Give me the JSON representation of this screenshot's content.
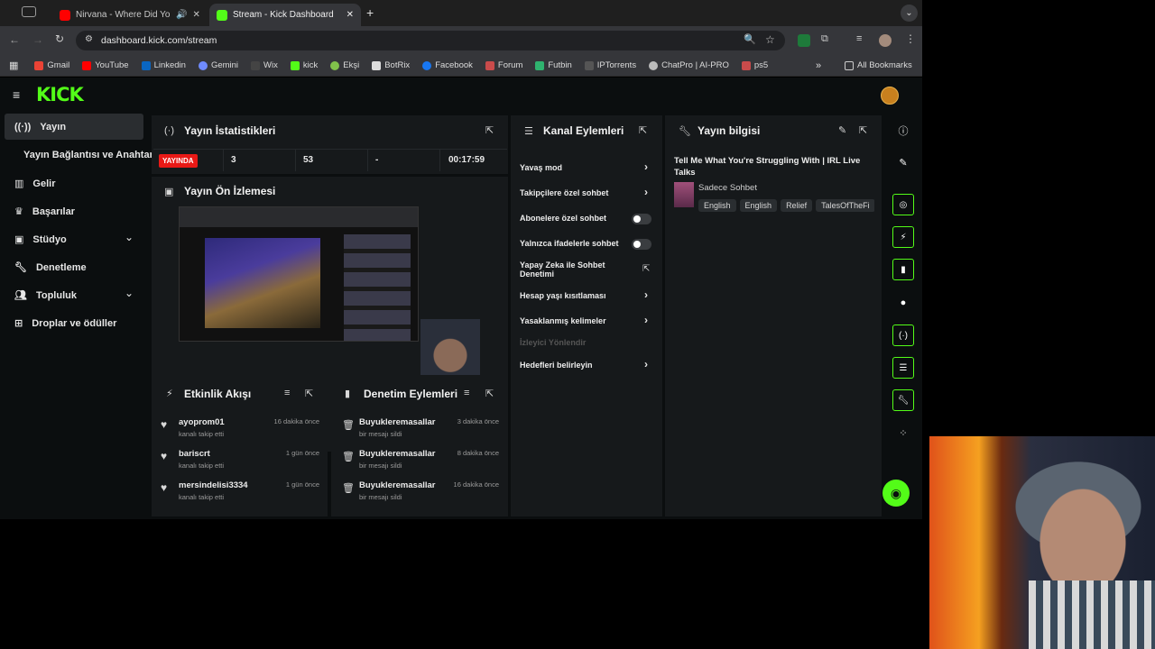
{
  "browser": {
    "tabs": [
      {
        "title": "Nirvana - Where Did You S",
        "audio": "speaker-icon"
      },
      {
        "title": "Stream - Kick Dashboard"
      }
    ],
    "url": "dashboard.kick.com/stream",
    "bookmarks": [
      "Gmail",
      "YouTube",
      "Linkedin",
      "Gemini",
      "Wix",
      "kick",
      "Ekşi",
      "BotRix",
      "Facebook",
      "Forum",
      "Futbin",
      "IPTorrents",
      "ChatPro | AI-PRO",
      "ps5"
    ],
    "all_bookmarks": "All Bookmarks"
  },
  "sidebar": {
    "items": [
      {
        "label": "Yayın",
        "icon": "broadcast-icon"
      },
      {
        "label": "Yayın Bağlantısı ve Anahtarı"
      },
      {
        "label": "Gelir",
        "icon": "chart-icon"
      },
      {
        "label": "Başarılar",
        "icon": "trophy-icon"
      },
      {
        "label": "Stüdyo",
        "icon": "video-icon"
      },
      {
        "label": "Denetleme",
        "icon": "wrench-icon"
      },
      {
        "label": "Topluluk",
        "icon": "people-icon"
      },
      {
        "label": "Droplar ve ödüller",
        "icon": "gift-icon"
      }
    ]
  },
  "stats": {
    "title": "Yayın İstatistikleri",
    "live_badge": "YAYINDA",
    "viewers": "3",
    "followers": "53",
    "subs": "-",
    "uptime": "00:17:59"
  },
  "preview": {
    "title": "Yayın Ön İzlemesi"
  },
  "activity": {
    "title": "Etkinlik Akışı",
    "items": [
      {
        "name": "ayoprom01",
        "sub": "kanalı takip etti",
        "time": "16 dakika önce"
      },
      {
        "name": "bariscrt",
        "sub": "kanalı takip etti",
        "time": "1 gün önce"
      },
      {
        "name": "mersindelisi3334",
        "sub": "kanalı takip etti",
        "time": "1 gün önce"
      }
    ]
  },
  "moderation": {
    "title": "Denetim Eylemleri",
    "items": [
      {
        "name": "Buyukleremasallar",
        "sub": "bir mesajı sildi",
        "time": "3 dakika önce"
      },
      {
        "name": "Buyukleremasallar",
        "sub": "bir mesajı sildi",
        "time": "8 dakika önce"
      },
      {
        "name": "Buyukleremasallar",
        "sub": "bir mesajı sildi",
        "time": "16 dakika önce"
      }
    ]
  },
  "channel_actions": {
    "title": "Kanal Eylemleri",
    "items": [
      {
        "label": "Yavaş mod",
        "control": "chevron"
      },
      {
        "label": "Takipçilere özel sohbet",
        "control": "chevron"
      },
      {
        "label": "Abonelere özel sohbet",
        "control": "toggle-off"
      },
      {
        "label": "Yalnızca ifadelerle sohbet",
        "control": "toggle-off"
      },
      {
        "label": "Yapay Zeka ile Sohbet Denetimi",
        "control": "external"
      },
      {
        "label": "Hesap yaşı kısıtlaması",
        "control": "chevron"
      },
      {
        "label": "Yasaklanmış kelimeler",
        "control": "chevron"
      },
      {
        "label": "İzleyici Yönlendir",
        "control": "disabled"
      },
      {
        "label": "Hedefleri belirleyin",
        "control": "chevron"
      }
    ]
  },
  "stream_info": {
    "title": "Yayın bilgisi",
    "stream_title": "Tell Me What You're Struggling With | IRL Live Talks",
    "category": "Sadece Sohbet",
    "tags": [
      "English",
      "English",
      "Relief",
      "TalesOfTheFi"
    ]
  },
  "colors": {
    "brand": "#53fc18",
    "live": "#e91916",
    "bg": "#0b0e0f",
    "panel": "#16191b"
  }
}
